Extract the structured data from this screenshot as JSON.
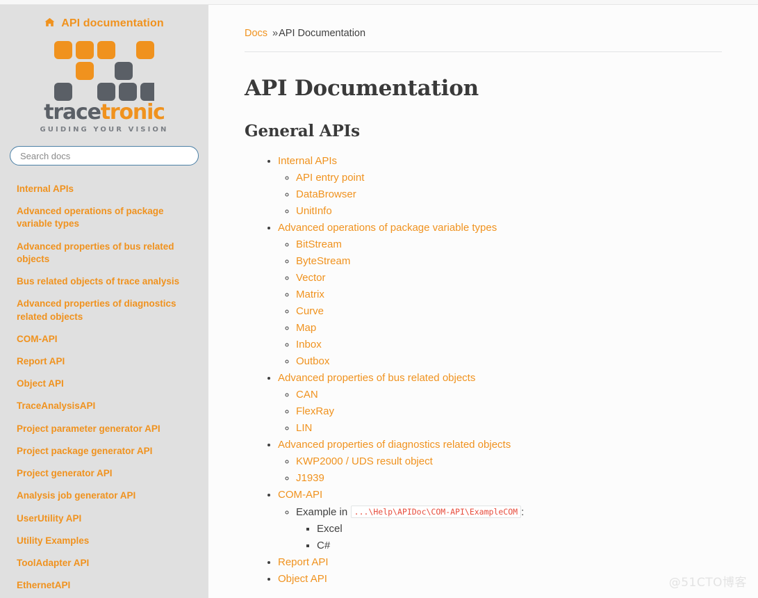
{
  "sidebar": {
    "brand_label": "API documentation",
    "home_icon": "home-icon",
    "logo": {
      "wordmark_dark": "trace",
      "wordmark_orange": "tronic",
      "tagline": "GUIDING YOUR VISION",
      "orange_hex": "#F0921E",
      "gray_hex": "#5A5F66",
      "cells": [
        {
          "row": 0,
          "col": 0,
          "color": "orange"
        },
        {
          "row": 0,
          "col": 1,
          "color": "orange"
        },
        {
          "row": 0,
          "col": 2,
          "color": "orange"
        },
        {
          "row": 0,
          "col": 4,
          "color": "orange"
        },
        {
          "row": 1,
          "col": 1,
          "color": "orange"
        },
        {
          "row": 1,
          "col": 3,
          "color": "gray"
        },
        {
          "row": 2,
          "col": 0,
          "color": "gray"
        },
        {
          "row": 2,
          "col": 2,
          "color": "gray"
        },
        {
          "row": 2,
          "col": 3,
          "color": "gray"
        },
        {
          "row": 2,
          "col": 4,
          "color": "gray"
        }
      ]
    },
    "search": {
      "placeholder": "Search docs",
      "value": ""
    },
    "nav_items": [
      "Internal APIs",
      "Advanced operations of package variable types",
      "Advanced properties of bus related objects",
      "Bus related objects of trace analysis",
      "Advanced properties of diagnostics related objects",
      "COM-API",
      "Report API",
      "Object API",
      "TraceAnalysisAPI",
      "Project parameter generator API",
      "Project package generator API",
      "Project generator API",
      "Analysis job generator API",
      "UserUtility API",
      "Utility Examples",
      "ToolAdapter API",
      "EthernetAPI"
    ]
  },
  "content": {
    "breadcrumb": {
      "root": "Docs",
      "separator": "»",
      "current": "API Documentation"
    },
    "title": "API Documentation",
    "section_heading": "General APIs",
    "toc": [
      {
        "label": "Internal APIs",
        "link": true,
        "children": [
          {
            "label": "API entry point",
            "link": true
          },
          {
            "label": "DataBrowser",
            "link": true
          },
          {
            "label": "UnitInfo",
            "link": true
          }
        ]
      },
      {
        "label": "Advanced operations of package variable types",
        "link": true,
        "children": [
          {
            "label": "BitStream",
            "link": true
          },
          {
            "label": "ByteStream",
            "link": true
          },
          {
            "label": "Vector",
            "link": true
          },
          {
            "label": "Matrix",
            "link": true
          },
          {
            "label": "Curve",
            "link": true
          },
          {
            "label": "Map",
            "link": true
          },
          {
            "label": "Inbox",
            "link": true
          },
          {
            "label": "Outbox",
            "link": true
          }
        ]
      },
      {
        "label": "Advanced properties of bus related objects",
        "link": true,
        "children": [
          {
            "label": "CAN",
            "link": true
          },
          {
            "label": "FlexRay",
            "link": true
          },
          {
            "label": "LIN",
            "link": true
          }
        ]
      },
      {
        "label": "Advanced properties of diagnostics related objects",
        "link": true,
        "children": [
          {
            "label": "KWP2000 / UDS result object",
            "link": true
          },
          {
            "label": "J1939",
            "link": true
          }
        ]
      },
      {
        "label": "COM-API",
        "link": true,
        "children": [
          {
            "label_before": "Example in",
            "code": "...\\Help\\APIDoc\\COM-API\\ExampleCOM",
            "label_after": ":",
            "link": false,
            "children": [
              {
                "label": "Excel",
                "link": false
              },
              {
                "label": "C#",
                "link": false
              }
            ]
          }
        ]
      },
      {
        "label": "Report API",
        "link": true,
        "children": []
      },
      {
        "label": "Object API",
        "link": true,
        "children": []
      }
    ]
  },
  "watermark": "@51CTO博客"
}
